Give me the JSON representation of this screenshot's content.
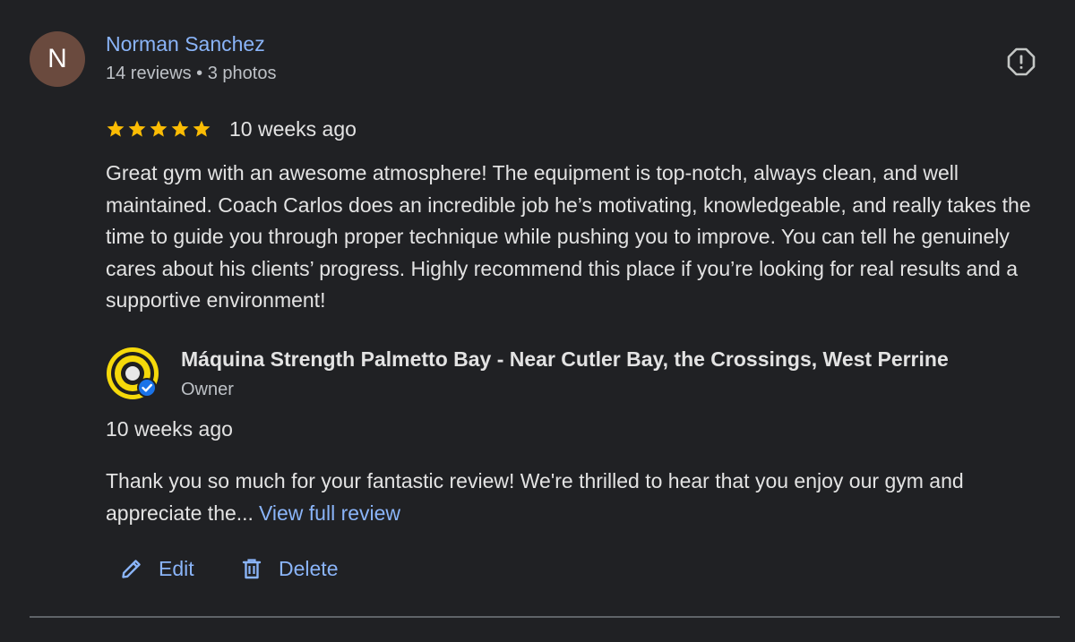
{
  "reviewer": {
    "initial": "N",
    "name": "Norman Sanchez",
    "meta": "14 reviews • 3 photos",
    "avatar_color": "#6a4a3e"
  },
  "review": {
    "rating": 5,
    "star_color": "#fbbc04",
    "date": "10 weeks ago",
    "text": "Great gym with an awesome atmosphere! The equipment is top-notch, always clean, and well maintained. Coach Carlos does an incredible job he’s motivating, knowledgeable, and really takes the time to guide you through proper technique while pushing you to improve. You can tell he genuinely cares about his clients’ progress. Highly recommend this place if you’re looking for real results and a supportive environment!"
  },
  "owner_reply": {
    "business_name": "Máquina Strength Palmetto Bay - Near Cutler Bay, the Crossings, West Perrine",
    "role": "Owner",
    "date": "10 weeks ago",
    "text": "Thank you so much for your fantastic review! We're thrilled to hear that you enjoy our gym and appreciate the...",
    "view_full_label": "View full review",
    "verified_icon": "verified-badge-icon"
  },
  "actions": {
    "edit_label": "Edit",
    "delete_label": "Delete"
  },
  "icons": {
    "report": "report-icon",
    "edit": "pencil-icon",
    "delete": "trash-icon",
    "star": "star-icon"
  },
  "colors": {
    "background": "#202124",
    "link": "#8ab4f8",
    "text": "#e3e3e3",
    "secondary_text": "#bdc1c6",
    "verified": "#1a73e8"
  }
}
